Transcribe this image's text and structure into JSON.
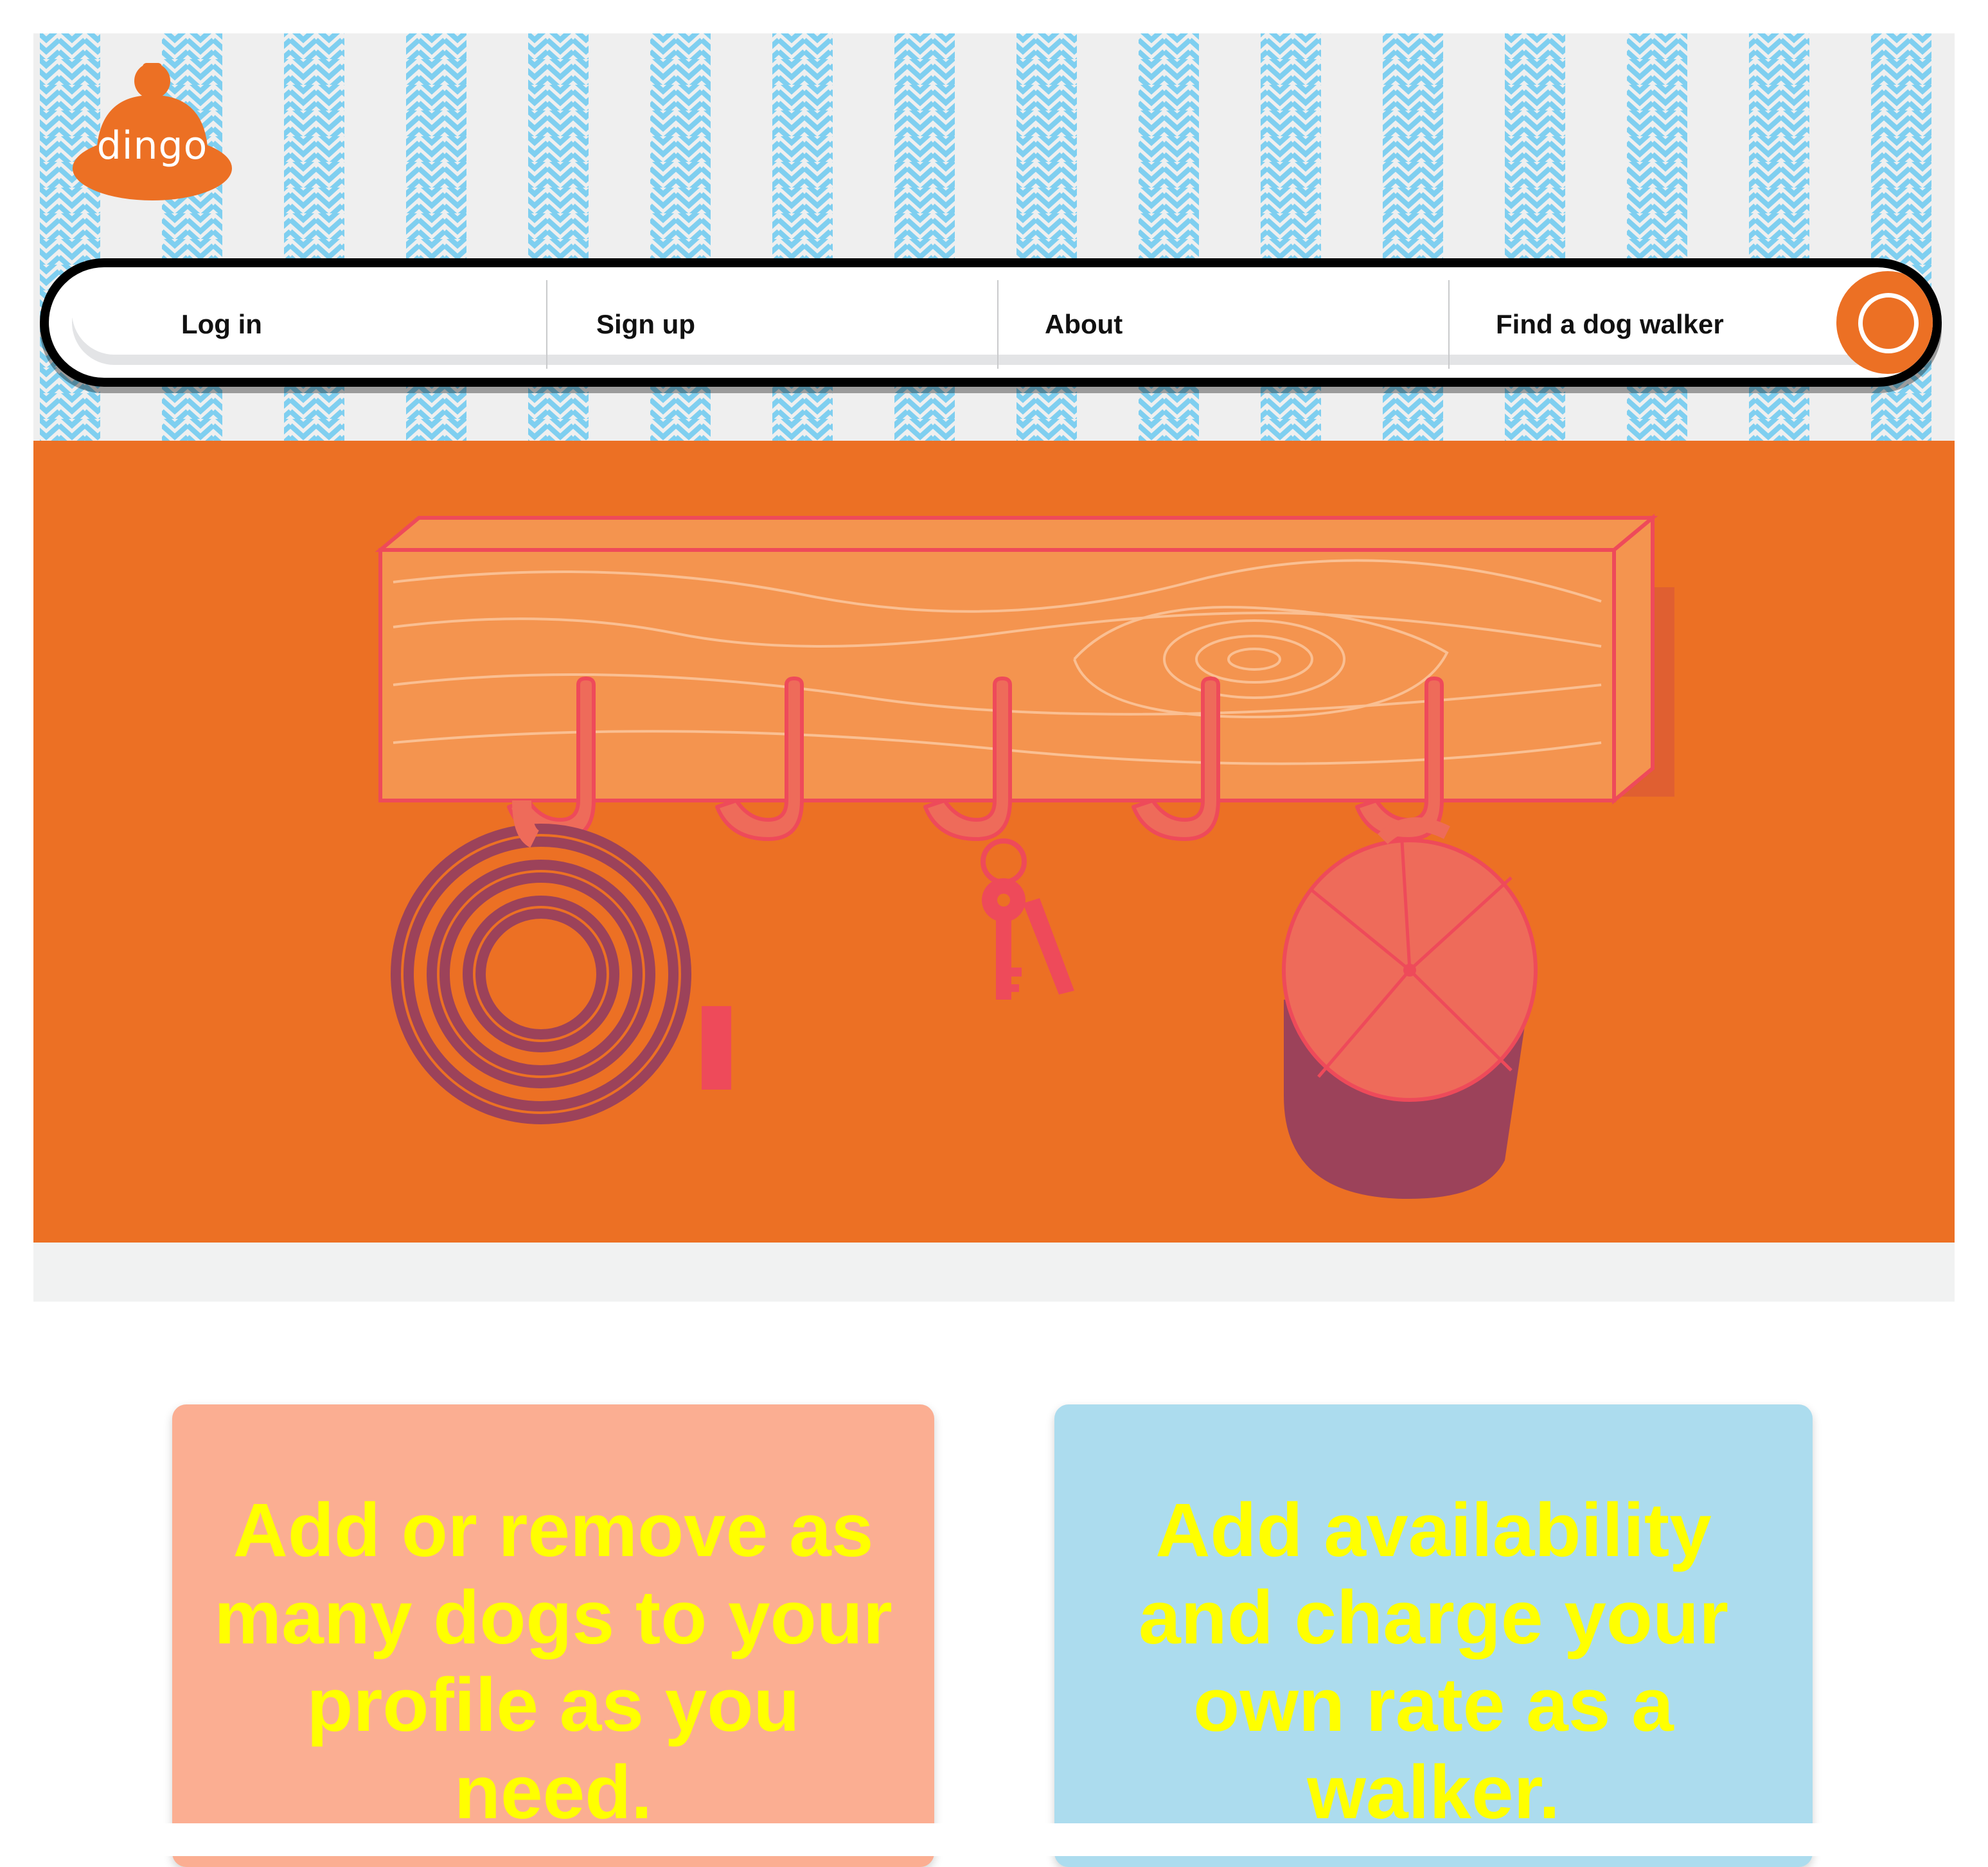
{
  "logo": {
    "text": "dingo"
  },
  "nav": {
    "items": [
      {
        "label": "Log in"
      },
      {
        "label": "Sign up"
      },
      {
        "label": "About"
      },
      {
        "label": "Find a dog walker"
      }
    ]
  },
  "features": [
    {
      "text": "Add or remove as many dogs to your profile as you need."
    },
    {
      "text": "Add availability and charge your own rate as a walker."
    }
  ],
  "colors": {
    "brand_orange": "#ec7024",
    "stripe_blue": "#7fcff0",
    "card_salmon": "#fbae92",
    "card_blue": "#acdcee",
    "card_text": "#ffff00",
    "hook_red": "#ee6b5a",
    "leash_purple": "#9c425a"
  },
  "icons": [
    "dingo-bell-logo-icon",
    "search-icon"
  ],
  "hero": {
    "illustration": "wooden-coat-rack-with-leash-keys-and-cap"
  }
}
